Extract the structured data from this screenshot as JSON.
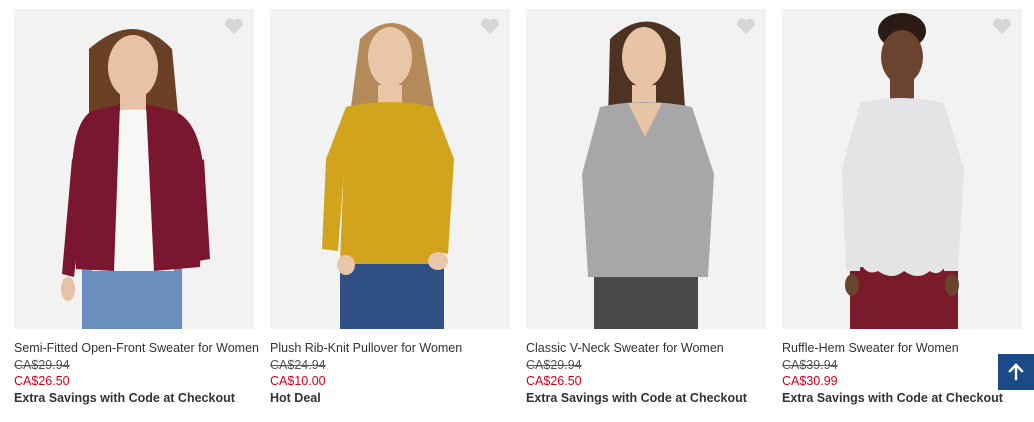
{
  "products": [
    {
      "name": "Semi-Fitted Open-Front Sweater for Women",
      "was_price": "CA$29.94",
      "now_price": "CA$26.50",
      "promo": "Extra Savings with Code at Checkout",
      "colors": {
        "top": "#7a1630",
        "inner": "#f7f7f5",
        "pants": "#6a8fbf",
        "skin": "#e6c3a6",
        "hair": "#6b4026"
      }
    },
    {
      "name": "Plush Rib-Knit Pullover for Women",
      "was_price": "CA$24.94",
      "now_price": "CA$10.00",
      "promo": "Hot Deal",
      "colors": {
        "top": "#d2a41c",
        "inner": "#d2a41c",
        "pants": "#2f4f85",
        "skin": "#e9c6a8",
        "hair": "#b48a5a"
      }
    },
    {
      "name": "Classic V-Neck Sweater for Women",
      "was_price": "CA$29.94",
      "now_price": "CA$26.50",
      "promo": "Extra Savings with Code at Checkout",
      "colors": {
        "top": "#a7a7a9",
        "inner": "#a7a7a9",
        "pants": "#4a4a4a",
        "skin": "#e8c4a6",
        "hair": "#4e3222"
      }
    },
    {
      "name": "Ruffle-Hem Sweater for Women",
      "was_price": "CA$39.94",
      "now_price": "CA$30.99",
      "promo": "Extra Savings with Code at Checkout",
      "colors": {
        "top": "#e4e4e6",
        "inner": "#e4e4e6",
        "pants": "#7a1b2b",
        "skin": "#6b4430",
        "hair": "#2a1b14"
      }
    }
  ],
  "icons": {
    "favorite": "heart-icon",
    "back_to_top": "arrow-up-icon"
  },
  "accent_colors": {
    "sale_price": "#d0021b",
    "back_to_top": "#1b4b86"
  }
}
